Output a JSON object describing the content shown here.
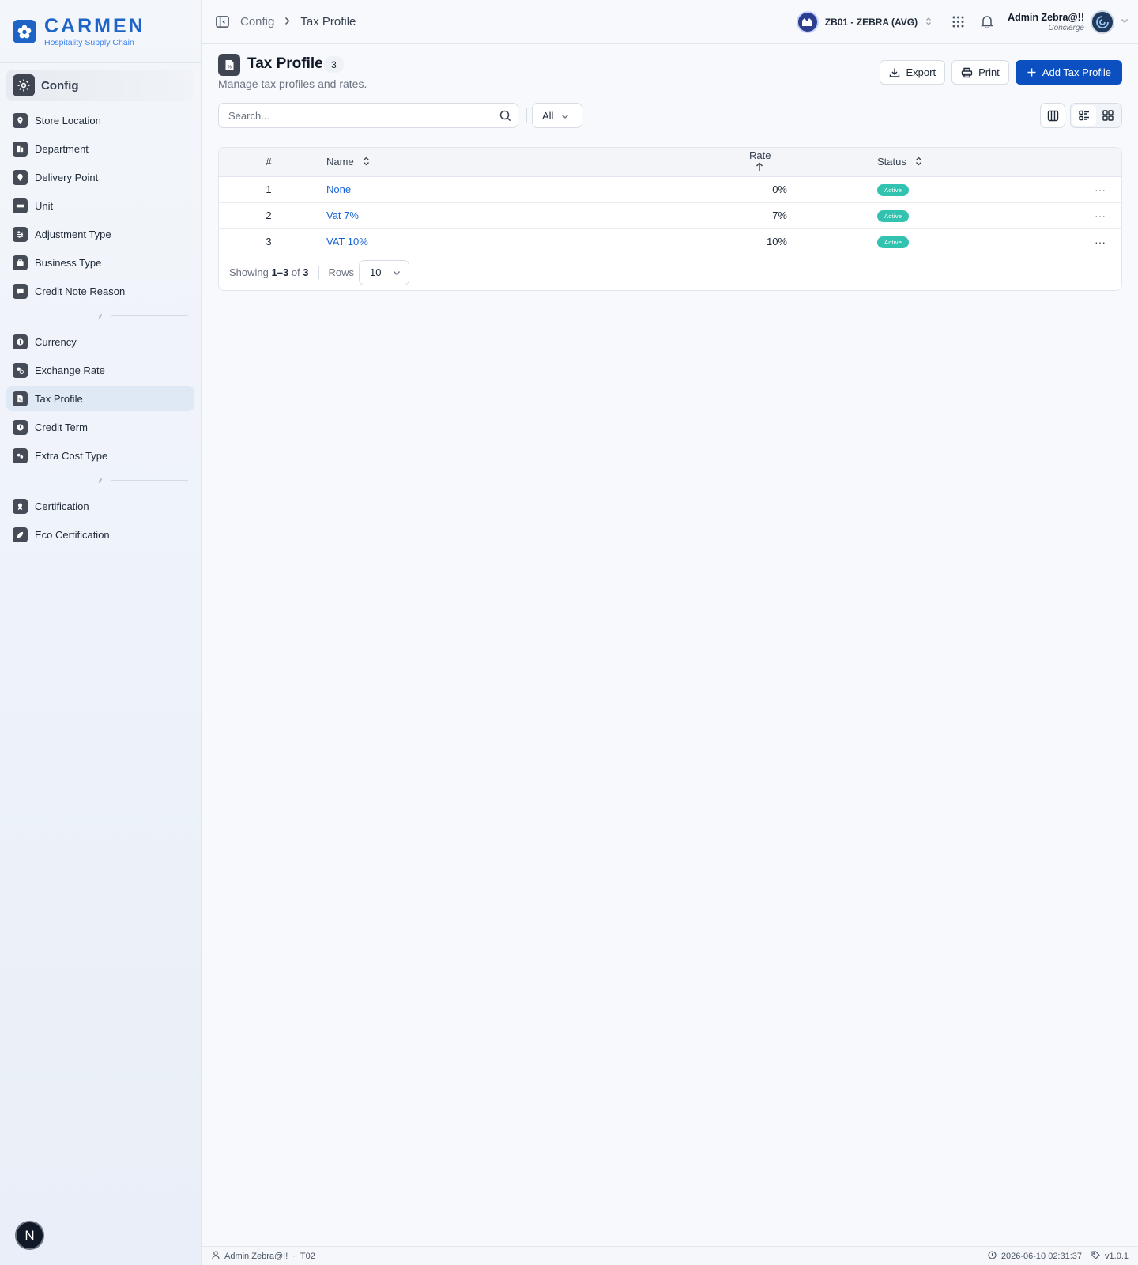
{
  "brand": {
    "name": "CARMEN",
    "subtitle": "Hospitality Supply Chain"
  },
  "module": {
    "label": "Config"
  },
  "sidebar": {
    "group1": [
      {
        "label": "Store Location",
        "icon": "map-pin-icon"
      },
      {
        "label": "Department",
        "icon": "building-icon"
      },
      {
        "label": "Delivery Point",
        "icon": "map-pin-icon"
      },
      {
        "label": "Unit",
        "icon": "ruler-icon"
      },
      {
        "label": "Adjustment Type",
        "icon": "sliders-icon"
      },
      {
        "label": "Business Type",
        "icon": "briefcase-icon"
      },
      {
        "label": "Credit Note Reason",
        "icon": "message-icon"
      }
    ],
    "group2": [
      {
        "label": "Currency",
        "icon": "coin-icon"
      },
      {
        "label": "Exchange Rate",
        "icon": "exchange-icon"
      },
      {
        "label": "Tax Profile",
        "icon": "file-percent-icon",
        "active": true
      },
      {
        "label": "Credit Term",
        "icon": "clock-icon"
      },
      {
        "label": "Extra Cost Type",
        "icon": "coins-icon"
      }
    ],
    "group3": [
      {
        "label": "Certification",
        "icon": "award-icon"
      },
      {
        "label": "Eco Certification",
        "icon": "leaf-icon"
      }
    ]
  },
  "header": {
    "breadcrumb_parent": "Config",
    "breadcrumb_current": "Tax Profile",
    "business_unit": "ZB01 - ZEBRA (AVG)",
    "user_name": "Admin Zebra@!!",
    "user_role": "Concierge"
  },
  "page": {
    "title": "Tax Profile",
    "count": "3",
    "description": "Manage tax profiles and rates.",
    "export_label": "Export",
    "print_label": "Print",
    "add_label": "Add Tax Profile",
    "search_placeholder": "Search...",
    "status_filter": "All"
  },
  "table": {
    "columns": {
      "num": "#",
      "name": "Name",
      "rate": "Rate",
      "status": "Status"
    },
    "rows": [
      {
        "num": "1",
        "name": "None",
        "rate": "0%",
        "status": "Active"
      },
      {
        "num": "2",
        "name": "Vat 7%",
        "rate": "7%",
        "status": "Active"
      },
      {
        "num": "3",
        "name": "VAT 10%",
        "rate": "10%",
        "status": "Active"
      }
    ],
    "more_label": "···"
  },
  "pagination": {
    "showing_label": "Showing",
    "range": "1–3",
    "of_label": "of",
    "total": "3",
    "rows_label": "Rows",
    "rows_value": "10"
  },
  "footer": {
    "user": "Admin Zebra@!!",
    "tenant": "T02",
    "timestamp": "2026-06-10 02:31:37",
    "version": "v1.0.1"
  },
  "fab": {
    "label": "N"
  },
  "colors": {
    "primary": "#0b4fc0",
    "brand": "#1e63c6",
    "active_badge": "#32c3b0",
    "link": "#1864d6"
  }
}
